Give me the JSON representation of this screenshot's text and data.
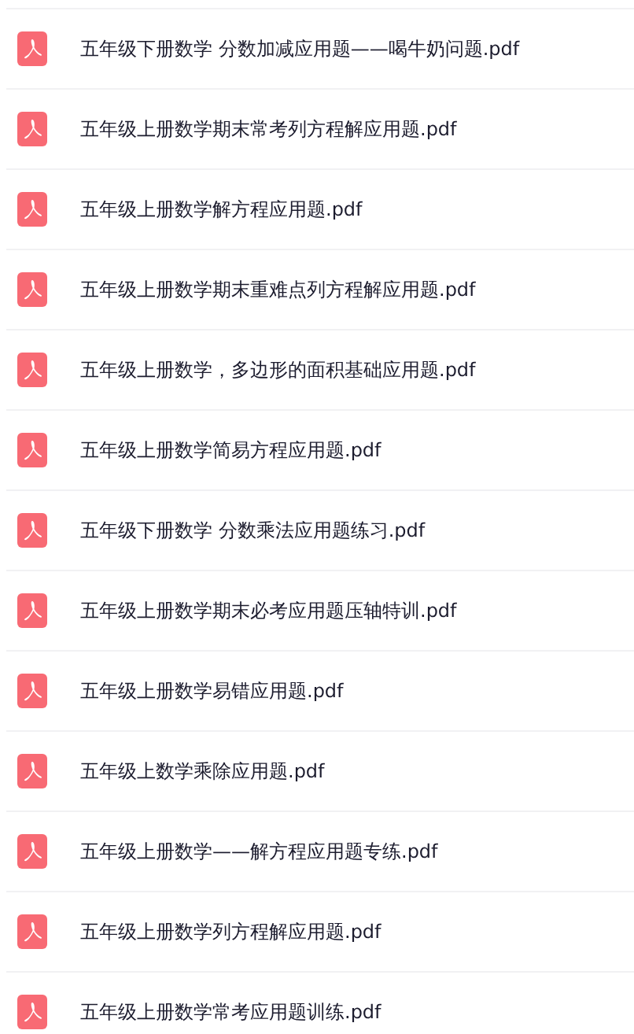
{
  "files": [
    {
      "name": "五年级下册数学 分数加减应用题——喝牛奶问题.pdf"
    },
    {
      "name": "五年级上册数学期末常考列方程解应用题.pdf"
    },
    {
      "name": "五年级上册数学解方程应用题.pdf"
    },
    {
      "name": "五年级上册数学期末重难点列方程解应用题.pdf"
    },
    {
      "name": "五年级上册数学，多边形的面积基础应用题.pdf"
    },
    {
      "name": "五年级上册数学简易方程应用题.pdf"
    },
    {
      "name": "五年级下册数学 分数乘法应用题练习.pdf"
    },
    {
      "name": "五年级上册数学期末必考应用题压轴特训.pdf"
    },
    {
      "name": "五年级上册数学易错应用题.pdf"
    },
    {
      "name": "五年级上数学乘除应用题.pdf"
    },
    {
      "name": "五年级上册数学——解方程应用题专练.pdf"
    },
    {
      "name": "五年级上册数学列方程解应用题.pdf"
    },
    {
      "name": "五年级上册数学常考应用题训练.pdf"
    }
  ]
}
